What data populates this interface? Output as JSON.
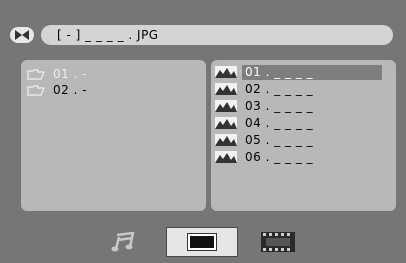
{
  "topbar": {
    "icon": "disc-icon",
    "path_text": "[ - ] _ _ _ _ . JPG"
  },
  "folders": [
    {
      "label": "01 . -",
      "selected": true
    },
    {
      "label": "02 . -",
      "selected": false
    }
  ],
  "files": [
    {
      "label": "01 . _ _ _ _",
      "selected": true
    },
    {
      "label": "02 . _ _ _ _",
      "selected": false
    },
    {
      "label": "03 . _ _ _ _",
      "selected": false
    },
    {
      "label": "04 . _ _ _ _",
      "selected": false
    },
    {
      "label": "05 . _ _ _ _",
      "selected": false
    },
    {
      "label": "06 . _ _ _ _",
      "selected": false
    }
  ],
  "tabs": [
    {
      "id": "music",
      "icon": "music-note-icon",
      "active": false
    },
    {
      "id": "photo",
      "icon": "photo-frame-icon",
      "active": true
    },
    {
      "id": "video",
      "icon": "film-strip-icon",
      "active": false
    }
  ],
  "colors": {
    "background": "#767676",
    "panel": "#b8b8b8",
    "selection": "#7e7e7e",
    "field": "#d4d4d4"
  }
}
